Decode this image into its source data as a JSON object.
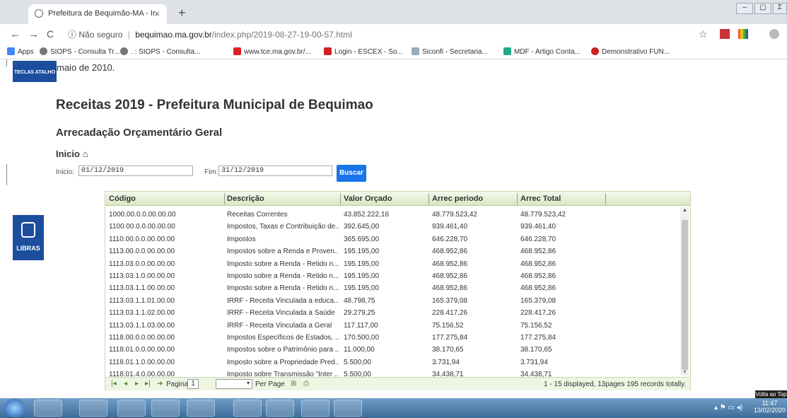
{
  "browser": {
    "tab_title": "Prefeitura de Bequimão-MA - Ir",
    "tab_close": "×",
    "new_tab": "+",
    "url_secure": "Não seguro",
    "url_host": "bequimao.ma.gov.br",
    "url_path": "/index.php/2019-08-27-19-00-57.html",
    "bookmarks": [
      "Apps",
      "SIOPS - Consulta Tr...",
      ". : SIOPS - Consulta...",
      "www.tce.ma.gov.br/...",
      "Login - ESCEX - So...",
      "Siconfi - Secretaria...",
      "MDF - Artigo Conta...",
      "Demonstrativo FUN..."
    ]
  },
  "page": {
    "teclas": "TECLAS ATALHO",
    "intro_text": "maio de 2010.",
    "title": "Receitas 2019 - Prefeitura Municipal de Bequimao",
    "subtitle": "Arrecadação Orçamentário Geral",
    "breadcrumb": "Inicio",
    "filter": {
      "start_label": "Inicio:",
      "start_value": "01/12/2019",
      "end_label": "Fim:",
      "end_value": "31/12/2019",
      "search_button": "Buscar"
    },
    "libras": "LIBRAS",
    "back_to_top": "Volta ao Top"
  },
  "grid": {
    "columns": [
      "Código",
      "Descrição",
      "Valor Orçado",
      "Arrec periodo",
      "Arrec Total"
    ],
    "rows": [
      [
        "1000.00.0.0.00.00.00",
        "Receitas Correntes",
        "43.852.222,16",
        "48.779.523,42",
        "48.779.523,42"
      ],
      [
        "1100.00.0.0.00.00.00",
        "Impostos, Taxas e Contribuição de...",
        "392.645,00",
        "939.461,40",
        "939.461,40"
      ],
      [
        "1110.00.0.0.00.00.00",
        "Impostos",
        "365.695,00",
        "646.228,70",
        "646.228,70"
      ],
      [
        "1113.00.0.0.00.00.00",
        "Impostos sobre a Renda e Proven...",
        "195.195,00",
        "468.952,86",
        "468.952,86"
      ],
      [
        "1113.03.0.0.00.00.00",
        "Imposto sobre a Renda - Retido n...",
        "195.195,00",
        "468.952,86",
        "468.952,86"
      ],
      [
        "1113.03.1.0.00.00.00",
        "Imposto sobre a Renda - Retido n...",
        "195.195,00",
        "468.952,86",
        "468.952,86"
      ],
      [
        "1113.03.1.1.00.00.00",
        "Imposto sobre a Renda - Retido n...",
        "195.195,00",
        "468.952,86",
        "468.952,86"
      ],
      [
        "1113.03.1.1.01.00.00",
        "IRRF - Receita Vinculada a educa...",
        "48.798,75",
        "165.379,08",
        "165.379,08"
      ],
      [
        "1113.03.1.1.02.00.00",
        "IRRF - Receita Vinculada a Saúde",
        "29.279,25",
        "228.417,26",
        "228.417,26"
      ],
      [
        "1113.03.1.1.03.00.00",
        "IRRF - Receita Vinculada a Geral",
        "117.117,00",
        "75.156,52",
        "75.156,52"
      ],
      [
        "1118.00.0.0.00.00.00",
        "Impostos Específicos de Estados, ...",
        "170.500,00",
        "177.275,84",
        "177.275,84"
      ],
      [
        "1118.01.0.0.00.00.00",
        "Impostos sobre o Patrimônio para ...",
        "11.000,00",
        "38.170,65",
        "38.170,65"
      ],
      [
        "1118.01.1.0.00.00.00",
        "Imposto sobre a Propriedade Pred...",
        "5.500,00",
        "3.731,94",
        "3.731,94"
      ],
      [
        "1118.01.4.0.00.00.00",
        "Imposto sobre Transmissão \"Inter ...",
        "5.500,00",
        "34.438,71",
        "34.438,71"
      ]
    ],
    "pager": {
      "pagina_label": "Pagina",
      "page_value": "1",
      "per_page_label": "Per Page",
      "info": "1 - 15 displayed, 13pages 195 records totally."
    }
  },
  "taskbar": {
    "time": "11:47",
    "date": "13/02/2020"
  }
}
